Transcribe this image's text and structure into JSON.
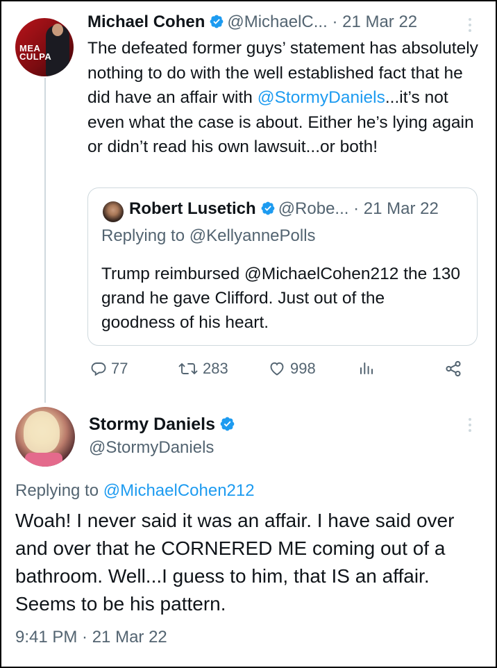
{
  "main_tweet": {
    "author_name": "Michael Cohen",
    "author_handle": "@MichaelC...",
    "date": "· 21 Mar 22",
    "avatar_text": "MEA\nCULPA",
    "text_before_mention": "The defeated former guys’ statement has absolutely nothing to do with the well established fact that he did have an affair with ",
    "mention": "@StormyDaniels",
    "text_after_mention": "...it’s not even what the case is about. Either he’s lying again or didn’t read his own lawsuit...or both!"
  },
  "quoted_tweet": {
    "author_name": "Robert Lusetich",
    "author_handle": "@Robe...",
    "date": "· 21 Mar 22",
    "replying_to": "Replying to @KellyannePolls",
    "text": "Trump reimbursed @MichaelCohen212 the 130 grand he gave Clifford. Just out of the goodness of his heart."
  },
  "actions": {
    "replies": "77",
    "retweets": "283",
    "likes": "998"
  },
  "reply_tweet": {
    "author_name": "Stormy Daniels",
    "author_handle": "@StormyDaniels",
    "replying_label": "Replying to ",
    "replying_handle": "@MichaelCohen212",
    "text": "Woah! I never said it was an affair. I have said over and over that he CORNERED ME coming out of a bathroom. Well...I guess to him, that IS an affair. Seems to be his pattern.",
    "timestamp": "9:41 PM · 21 Mar 22"
  },
  "colors": {
    "link": "#1d9bf0",
    "muted": "#536471",
    "verified": "#1d9bf0",
    "border": "#cfd9de"
  },
  "icons": [
    "verified-badge-icon",
    "more-options-icon",
    "reply-icon",
    "retweet-icon",
    "like-icon",
    "analytics-icon",
    "share-icon"
  ]
}
